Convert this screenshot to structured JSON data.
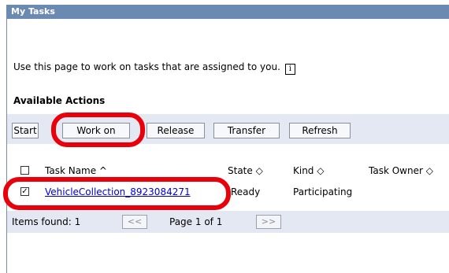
{
  "window": {
    "title": "My Tasks"
  },
  "intro": {
    "text": "Use this page to work on tasks that are assigned to you.",
    "info_icon": "i"
  },
  "actions": {
    "heading": "Available Actions",
    "buttons": {
      "start": "Start",
      "work_on": "Work on",
      "release": "Release",
      "transfer": "Transfer",
      "refresh": "Refresh"
    }
  },
  "table": {
    "columns": {
      "task_name": "Task Name ^",
      "state": "State ◇",
      "kind": "Kind ◇",
      "owner": "Task Owner ◇"
    },
    "rows": [
      {
        "checked": true,
        "check_mark": "✓",
        "task_name": "VehicleCollection_8923084271",
        "state": "Ready",
        "kind": "Participating"
      }
    ]
  },
  "pager": {
    "items_found": "Items found: 1",
    "prev": "<<",
    "page": "Page 1 of 1",
    "next": ">>"
  },
  "annotation_color": "#e8000a"
}
